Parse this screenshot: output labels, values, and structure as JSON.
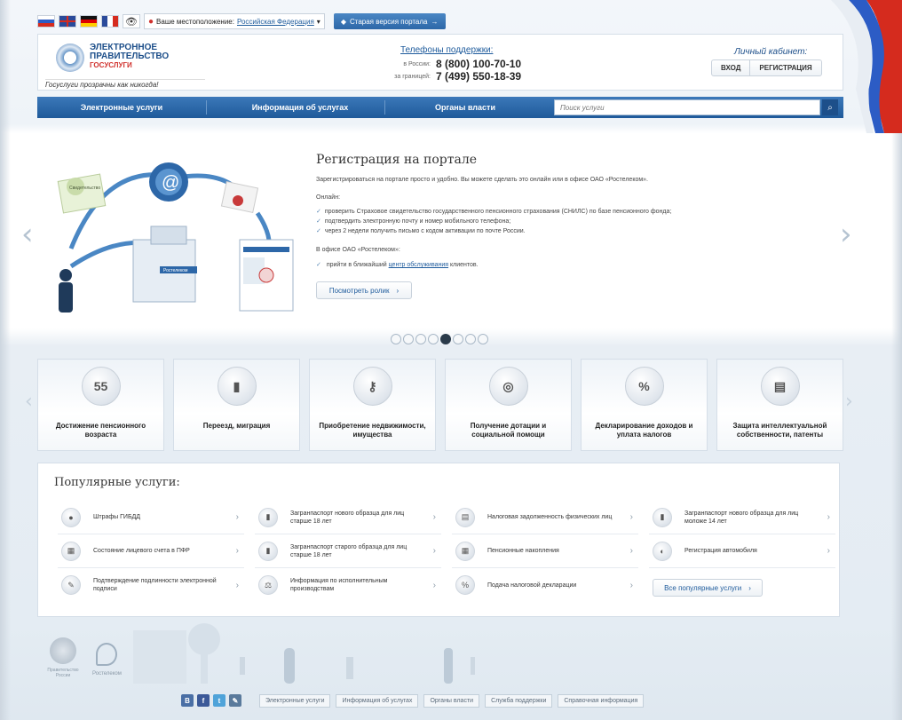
{
  "topbar": {
    "location_label": "Ваше местоположение:",
    "location_value": "Российская Федерация",
    "old_portal": "Старая версия портала"
  },
  "header": {
    "logo_line1": "ЭЛЕКТРОННОЕ",
    "logo_line2": "ПРАВИТЕЛЬСТВО",
    "logo_line3": "ГОСУСЛУГИ",
    "slogan": "Госуслуги прозрачны как никогда!",
    "support_title": "Телефоны поддержки:",
    "phone_label_ru": "в России:",
    "phone_ru": "8 (800) 100-70-10",
    "phone_label_abroad": "за границей:",
    "phone_abroad": "7 (499) 550-18-39",
    "cabinet_title": "Личный кабинет:",
    "login": "ВХОД",
    "register": "РЕГИСТРАЦИЯ"
  },
  "nav": {
    "items": [
      "Электронные услуги",
      "Информация об услугах",
      "Органы власти"
    ],
    "search_placeholder": "Поиск услуги"
  },
  "slide": {
    "title": "Регистрация на портале",
    "intro": "Зарегистрироваться на портале просто и удобно. Вы можете сделать это онлайн или в офисе ОАО «Ростелеком».",
    "online_label": "Онлайн:",
    "bullets": [
      "проверить Страховое свидетельство государственного пенсионного страхования (СНИЛС) по базе пенсионного фонда;",
      "подтвердить электронную почту и номер мобильного телефона;",
      "через 2 недели получить письмо с кодом активации по почте России."
    ],
    "office_label": "В офисе ОАО «Ростелеком»:",
    "office_item_prefix": "прийти в ближайший",
    "office_item_link": "центр обслуживания",
    "office_item_suffix": "клиентов.",
    "video_button": "Посмотреть ролик",
    "illus_badge": "Ростелеком",
    "illus_doc": "Свидетельство"
  },
  "slider_dots": {
    "count": 8,
    "active_index": 4
  },
  "categories": [
    {
      "label": "Достижение пенсионного возраста",
      "icon": "calendar-icon",
      "glyph": "55"
    },
    {
      "label": "Переезд, миграция",
      "icon": "passport-icon",
      "glyph": "▮"
    },
    {
      "label": "Приобретение недвижимости, имущества",
      "icon": "keys-icon",
      "glyph": "⚷"
    },
    {
      "label": "Получение дотации и социальной помощи",
      "icon": "lifebuoy-icon",
      "glyph": "◎"
    },
    {
      "label": "Декларирование доходов и уплата налогов",
      "icon": "percent-icon",
      "glyph": "%"
    },
    {
      "label": "Защита интеллектуальной собственности, патенты",
      "icon": "certificate-icon",
      "glyph": "▤"
    }
  ],
  "popular": {
    "title": "Популярные услуги:",
    "columns": [
      [
        {
          "text": "Штрафы ГИБДД",
          "icon": "traffic-light-icon",
          "glyph": "●"
        },
        {
          "text": "Состояние лицевого счета в ПФР",
          "icon": "pension-account-icon",
          "glyph": "▦"
        },
        {
          "text": "Подтверждение подлинности электронной подписи",
          "icon": "signature-icon",
          "glyph": "✎"
        }
      ],
      [
        {
          "text": "Загранпаспорт нового образца для лиц старше 18 лет",
          "icon": "passport-icon",
          "glyph": "▮"
        },
        {
          "text": "Загранпаспорт старого образца для лиц старше 18 лет",
          "icon": "passport-icon",
          "glyph": "▮"
        },
        {
          "text": "Информация по исполнительным производствам",
          "icon": "scales-icon",
          "glyph": "⚖"
        }
      ],
      [
        {
          "text": "Налоговая задолженность физических лиц",
          "icon": "tax-icon",
          "glyph": "▤"
        },
        {
          "text": "Пенсионные накопления",
          "icon": "savings-icon",
          "glyph": "▦"
        },
        {
          "text": "Подача налоговой декларации",
          "icon": "declaration-icon",
          "glyph": "%"
        }
      ],
      [
        {
          "text": "Загранпаспорт нового образца для лиц моложе 14 лет",
          "icon": "child-passport-icon",
          "glyph": "▮"
        },
        {
          "text": "Регистрация автомобиля",
          "icon": "car-icon",
          "glyph": "◐"
        }
      ]
    ],
    "all_button": "Все популярные услуги"
  },
  "footer": {
    "emblem_text": "Правительство России",
    "rt_text": "Ростелеком",
    "social": [
      {
        "name": "vk-icon",
        "glyph": "В",
        "color": "#4a6fa5"
      },
      {
        "name": "facebook-icon",
        "glyph": "f",
        "color": "#3b5998"
      },
      {
        "name": "twitter-icon",
        "glyph": "t",
        "color": "#4fa3d9"
      },
      {
        "name": "livejournal-icon",
        "glyph": "✎",
        "color": "#5a7a9c"
      }
    ],
    "links": [
      "Электронные услуги",
      "Информация об услугах",
      "Органы власти",
      "Служба поддержки",
      "Справочная информация"
    ]
  },
  "colors": {
    "accent_blue": "#1d4f8a",
    "nav_blue": "#2d67a8",
    "link_blue": "#1e5b9c",
    "brand_red": "#d0312d"
  }
}
